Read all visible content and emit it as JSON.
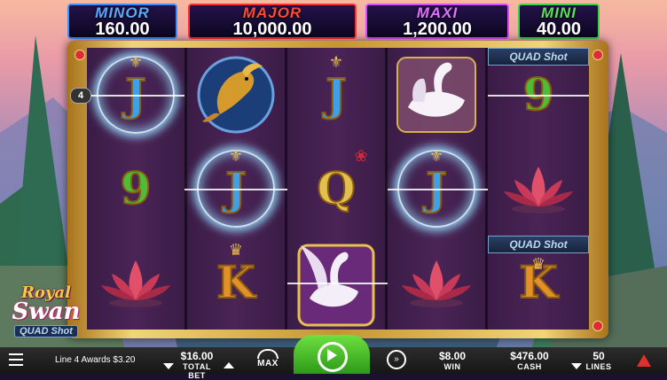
{
  "jackpots": [
    {
      "label": "MINOR",
      "value": "160.00",
      "color": "#3b8fff"
    },
    {
      "label": "MAJOR",
      "value": "10,000.00",
      "color": "#ff3030"
    },
    {
      "label": "MAXI",
      "value": "1,200.00",
      "color": "#d84cff"
    },
    {
      "label": "MINI",
      "value": "40.00",
      "color": "#3fd04a"
    }
  ],
  "reels": [
    [
      "J",
      "9",
      "lotus"
    ],
    [
      "koi-fish",
      "J",
      "K"
    ],
    [
      "J",
      "Q",
      "swan-wild"
    ],
    [
      "swan",
      "J",
      "lotus"
    ],
    [
      "9",
      "lotus",
      "K"
    ]
  ],
  "winning_line": {
    "number": "4"
  },
  "quad_shot_label": "QUAD Shot",
  "logo": {
    "line1": "Royal",
    "line2": "Swan",
    "line3": "QUAD Shot"
  },
  "bottom_bar": {
    "status_text": "Line 4 Awards $3.20",
    "total_bet_value": "$16.00",
    "total_bet_label": "TOTAL BET",
    "max_label": "MAX",
    "win_value": "$8.00",
    "win_label": "WIN",
    "cash_value": "$476.00",
    "cash_label": "CASH",
    "lines_value": "50",
    "lines_label": "LINES"
  },
  "colors": {
    "reel_background": "#3a1c46",
    "frame_gold": "#f2d479",
    "spin_green": "#3fb820",
    "bar_background": "#1e1e1e"
  }
}
